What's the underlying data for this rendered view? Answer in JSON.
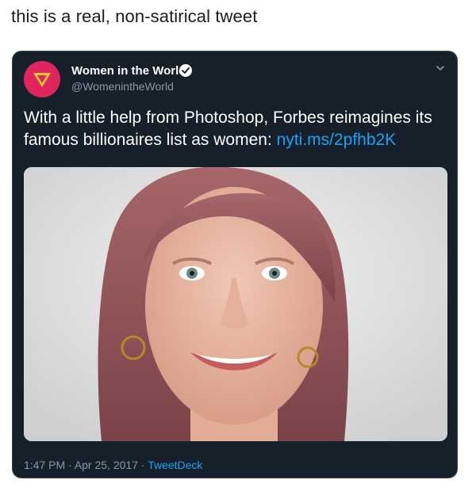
{
  "caption": "this is a real, non-satirical tweet",
  "tweet": {
    "display_name": "Women in the World",
    "handle": "@WomenintheWorld",
    "text": "With a little help from Photoshop, Forbes reimagines its famous billionaires list as women: ",
    "link": "nyti.ms/2pfhb2K",
    "time": "1:47 PM",
    "date": "Apr 25, 2017",
    "separator": " · ",
    "source": "TweetDeck"
  },
  "icons": {
    "avatar": "women-in-the-world-logo",
    "verified": "verified-badge-icon",
    "more": "chevron-down-icon"
  },
  "colors": {
    "card_bg": "#15202b",
    "avatar_bg": "#e0245e",
    "link": "#1da1f2",
    "secondary_text": "#8899a6",
    "verified": "#ffffff"
  }
}
